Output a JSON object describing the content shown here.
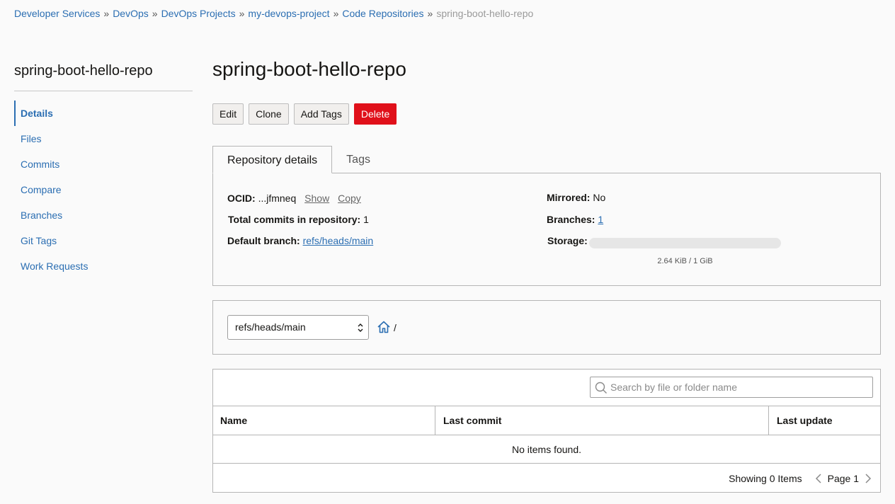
{
  "breadcrumb": {
    "items": [
      "Developer Services",
      "DevOps",
      "DevOps Projects",
      "my-devops-project",
      "Code Repositories"
    ],
    "separator": "»",
    "current": "spring-boot-hello-repo"
  },
  "sidebar": {
    "title": "spring-boot-hello-repo",
    "items": [
      {
        "label": "Details",
        "active": true
      },
      {
        "label": "Files"
      },
      {
        "label": "Commits"
      },
      {
        "label": "Compare"
      },
      {
        "label": "Branches"
      },
      {
        "label": "Git Tags"
      },
      {
        "label": "Work Requests"
      }
    ]
  },
  "page": {
    "title": "spring-boot-hello-repo"
  },
  "actions": {
    "edit": "Edit",
    "clone": "Clone",
    "add_tags": "Add Tags",
    "delete": "Delete"
  },
  "tabs": {
    "repo_details": "Repository details",
    "tags": "Tags"
  },
  "details": {
    "ocid_label": "OCID:",
    "ocid_value": "...jfmneq",
    "show": "Show",
    "copy": "Copy",
    "total_commits_label": "Total commits in repository:",
    "total_commits_value": "1",
    "default_branch_label": "Default branch:",
    "default_branch_value": "refs/heads/main",
    "mirrored_label": "Mirrored:",
    "mirrored_value": "No",
    "branches_label": "Branches:",
    "branches_value": "1",
    "storage_label": "Storage:",
    "storage_text": "2.64 KiB / 1 GiB",
    "storage_used_fraction": 0.0
  },
  "browser": {
    "branch_select": "refs/heads/main",
    "path": "/"
  },
  "files": {
    "search_placeholder": "Search by file or folder name",
    "columns": [
      "Name",
      "Last commit",
      "Last update"
    ],
    "empty_text": "No items found.",
    "showing": "Showing 0 Items",
    "page": "Page 1"
  },
  "colors": {
    "link": "#2b6eb2",
    "danger": "#e0101a"
  }
}
